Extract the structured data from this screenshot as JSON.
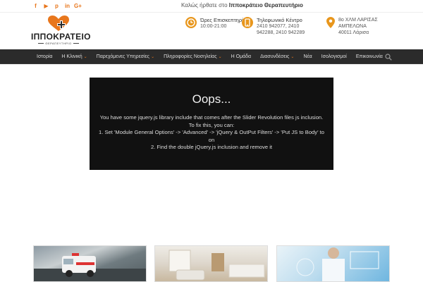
{
  "topbar": {
    "socials": [
      {
        "icon": "facebook-icon",
        "glyph": "f"
      },
      {
        "icon": "youtube-icon",
        "glyph": "▶"
      },
      {
        "icon": "pinterest-icon",
        "glyph": "p"
      },
      {
        "icon": "linkedin-icon",
        "glyph": "in"
      },
      {
        "icon": "google-plus-icon",
        "glyph": "G+"
      }
    ],
    "welcome_prefix": "Καλώς ήρθατε στο",
    "welcome_name": "Ιπποκράτειο Θεραπευτήριο"
  },
  "header": {
    "logo_title": "ΙΠΠΟΚΡΑΤΕΙΟ",
    "logo_subtitle": "ΘΕΡΑΠΕΥΤΗΡΙΟ",
    "hours": {
      "title": "Ώρες Επισκεπτηρίου",
      "value": "10:00-21:00"
    },
    "phone": {
      "title": "Τηλεφωνικό Κέντρο",
      "line1": "2410 942077, 2410",
      "line2": "942288, 2410 942289"
    },
    "address": {
      "line1": "8ο ΧΛΜ ΛΑΡΙΣΑΣ",
      "line2": "ΑΜΠΕΛΩΝΑ",
      "line3": "40011 Λάρισα"
    }
  },
  "nav": {
    "items": [
      {
        "label": "Ιστορία",
        "dropdown": false
      },
      {
        "label": "Η Κλινική",
        "dropdown": true
      },
      {
        "label": "Παρεχόμενες Υπηρεσίες",
        "dropdown": true
      },
      {
        "label": "Πληροφορίες Νοσηλείας",
        "dropdown": true
      },
      {
        "label": "Η Ομάδα",
        "dropdown": false
      },
      {
        "label": "Διασυνδέσεις",
        "dropdown": true
      },
      {
        "label": "Νέα",
        "dropdown": false
      },
      {
        "label": "Ισολογισμοί",
        "dropdown": false
      },
      {
        "label": "Επικοινωνία",
        "dropdown": false
      }
    ]
  },
  "error": {
    "title": "Oops...",
    "line1": "You have some jquery.js library include that comes after the Slider Revolution files js inclusion.",
    "line2": "To fix this, you can:",
    "line3": "1. Set 'Module General Options' -> 'Advanced' -> 'jQuery & OutPut Filters' -> 'Put JS to Body' to on",
    "line4": "2. Find the double jQuery.js inclusion and remove it"
  },
  "colors": {
    "accent": "#e8761c",
    "nav_bg": "#2b2b2b",
    "error_bg": "#111111"
  }
}
